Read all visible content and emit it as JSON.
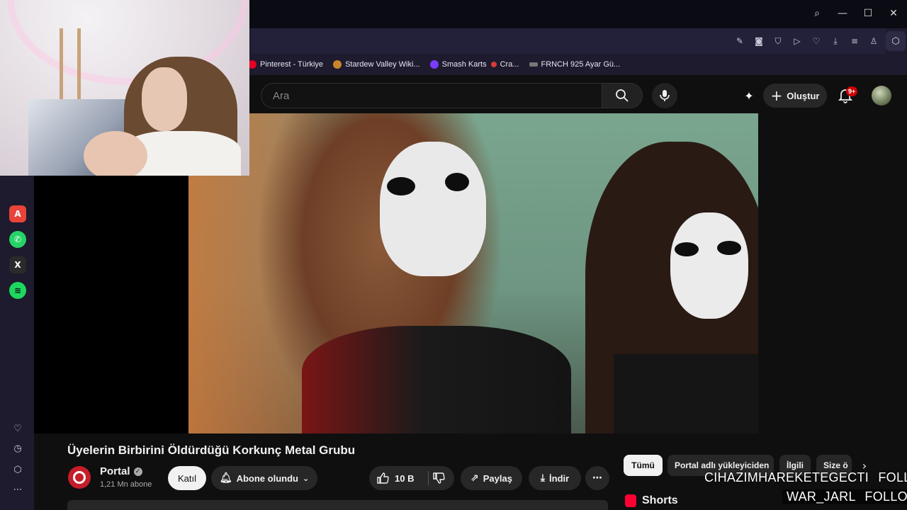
{
  "browser": {
    "window_controls": [
      "search-icon",
      "minimize-icon",
      "maximize-icon",
      "close-icon"
    ],
    "toolbar_icons": [
      "edit-icon",
      "camera-icon",
      "shield-icon",
      "play-icon",
      "heart-icon",
      "download-icon",
      "menu-icon",
      "account-icon"
    ],
    "bookmarks": [
      {
        "label": "Pinterest - Türkiye",
        "color": "#e60023"
      },
      {
        "label": "Stardew Valley Wiki...",
        "color": "#c8862a"
      },
      {
        "label": "Smash Karts",
        "color": "#7a3cff"
      },
      {
        "label": "Cra...",
        "color": "#d83a3a"
      },
      {
        "label": "FRNCH 925 Ayar Gü...",
        "color": "#777777"
      }
    ]
  },
  "sidebar": {
    "apps": [
      {
        "name": "aria-icon",
        "color": "#e8443a",
        "glyph": "A"
      },
      {
        "name": "whatsapp-icon",
        "color": "#25d366",
        "glyph": "✆"
      },
      {
        "name": "x-icon",
        "color": "#2a2a2a",
        "glyph": "X"
      },
      {
        "name": "spotify-icon",
        "color": "#1ed760",
        "glyph": "≋"
      }
    ],
    "bottom": [
      "heart-icon",
      "history-icon",
      "box-icon",
      "more-icon"
    ]
  },
  "youtube": {
    "search_placeholder": "Ara",
    "create_label": "Oluştur",
    "notification_count": "9+"
  },
  "video": {
    "title": "Üyelerin Birbirini Öldürdüğü Korkunç Metal Grubu",
    "channel": "Portal",
    "subscribers": "1,21 Mn abone",
    "join_label": "Katıl",
    "subscribed_label": "Abone olundu",
    "likes": "10 B",
    "share_label": "Paylaş",
    "download_label": "İndir"
  },
  "chips": [
    "Tümü",
    "Portal adlı yükleyiciden",
    "İlgili",
    "Size ö"
  ],
  "shorts_label": "Shorts",
  "overlay": {
    "line1_handle": "CIHAZIMHAREKETEGECTI",
    "line1_action": "FOLLOW",
    "line2_handle": "WAR_JARL",
    "line2_action": "FOLLOW"
  }
}
